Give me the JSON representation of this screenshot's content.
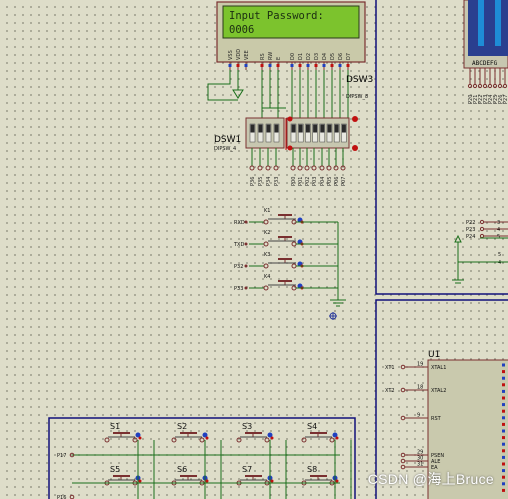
{
  "lcd": {
    "line1": "Input Password:",
    "line2": "0006",
    "pins": [
      "VSS",
      "VDD",
      "VEE",
      "RS",
      "RW",
      "E",
      "D0",
      "D1",
      "D2",
      "D3",
      "D4",
      "D5",
      "D6",
      "D7"
    ]
  },
  "dsw3": {
    "name": "DSW3",
    "part": "DIPSW_8"
  },
  "dsw1": {
    "name": "DSW1",
    "part": "DIPSW_4"
  },
  "dsw1_pins": [
    "P36",
    "P35",
    "P34",
    "P33"
  ],
  "dsw3_pins": [
    "P00",
    "P01",
    "P02",
    "P03",
    "P04",
    "P05",
    "P06",
    "P07"
  ],
  "keys_k": [
    {
      "net": "RXD",
      "ref": "K1"
    },
    {
      "net": "TXD",
      "ref": "K2"
    },
    {
      "net": "P32",
      "ref": "K3"
    },
    {
      "net": "P33",
      "ref": "K4"
    }
  ],
  "mcu": {
    "ref": "U1",
    "pins": [
      {
        "num": "19",
        "name": "XTAL1",
        "net": "XT1"
      },
      {
        "num": "18",
        "name": "XTAL2",
        "net": "XT2"
      },
      {
        "num": "9",
        "name": "RST",
        "net": ""
      },
      {
        "num": "29",
        "name": "PSEN",
        "net": ""
      },
      {
        "num": "30",
        "name": "ALE",
        "net": ""
      },
      {
        "num": "31",
        "name": "EA",
        "net": ""
      }
    ]
  },
  "seg_display": {
    "labels": "ABCDEFG",
    "pins": [
      "P20",
      "P21",
      "P22",
      "P23",
      "P24",
      "P25",
      "P26",
      "P27"
    ]
  },
  "right_nets": [
    "P22",
    "P23",
    "P24"
  ],
  "right_pin_nums": [
    "3",
    "4",
    "5"
  ],
  "matrix_keys": [
    "S1",
    "S2",
    "S3",
    "S4",
    "S5",
    "S6",
    "S7",
    "S8"
  ],
  "matrix_nets": [
    "P17",
    "P16"
  ],
  "watermark": "CSDN @海上Bruce"
}
